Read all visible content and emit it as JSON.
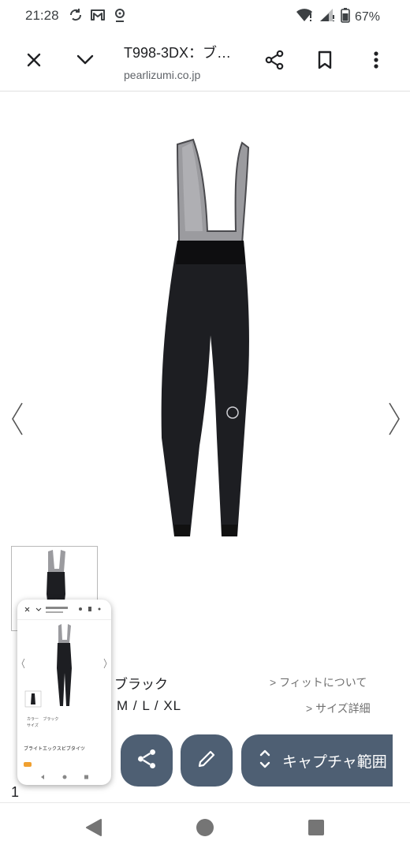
{
  "status": {
    "time": "21:28",
    "battery": "67%",
    "icons_left": [
      "sync-icon",
      "gmail-icon",
      "location-icon"
    ],
    "icons_right": [
      "wifi-icon",
      "signal-icon",
      "battery-icon"
    ]
  },
  "toolbar": {
    "title": "T998-3DX：ブ…",
    "url": "pearlizumi.co.jp"
  },
  "product": {
    "color_value": "ブラック",
    "sizes_value": "M / L / XL",
    "fit_link": "> フィットについて",
    "size_link": "> サイズ詳細",
    "price_peek": "1        "
  },
  "preview": {
    "url": "pearlizumi.co.jp",
    "title": "ブライトエックスビブタイツ",
    "color_label": "カラー",
    "color_value": "ブラック",
    "size_label": "サイズ"
  },
  "capture": {
    "share_icon": "share-icon",
    "edit_icon": "pencil-icon",
    "range_label": "キャプチャ範囲"
  },
  "colors": {
    "capture_button": "#4e5f73",
    "nav_icon": "#757575"
  }
}
